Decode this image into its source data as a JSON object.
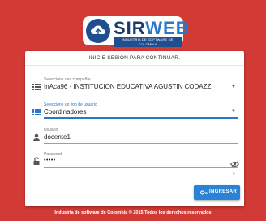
{
  "logo": {
    "sir": "SIR",
    "web": "WEB",
    "subtitle": "INDUSTRIA DE SOFTWARE DE COLOMBIA"
  },
  "card": {
    "title": "INICIE SESIÓN PARA CONTINUAR.",
    "company": {
      "label": "Seleccione una compañía",
      "value": "InAca96 - INSTITUCION EDUCATIVA AGUSTIN CODAZZI"
    },
    "user_type": {
      "label": "Seleccione un tipo de usuario",
      "value": "Coordinadores"
    },
    "username": {
      "label": "Usuario",
      "value": "docente1"
    },
    "password": {
      "label": "Password",
      "value": "•••••",
      "counter": "5"
    },
    "submit_label": "INGRESAR"
  },
  "footer": "Industria de software de Colombia © 2015 Todos los derechos reservados",
  "colors": {
    "background": "#d23a36",
    "accent": "#2a79c8",
    "button": "#2b83d6"
  },
  "icons": [
    "list-icon",
    "person-icon",
    "lock-open-icon",
    "eye-off-icon",
    "key-icon",
    "cloud-icon"
  ]
}
